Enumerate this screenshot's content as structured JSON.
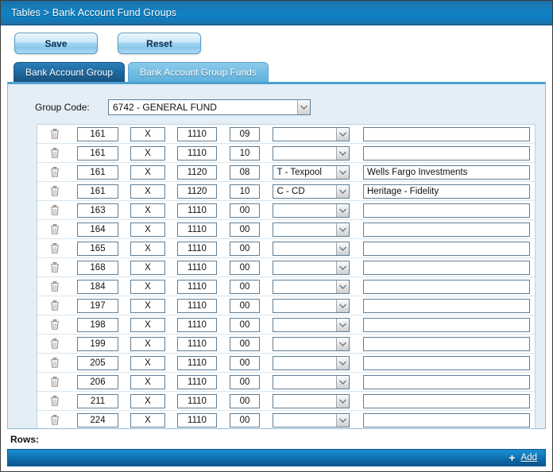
{
  "window": {
    "breadcrumb": "Tables > Bank Account Fund Groups"
  },
  "toolbar": {
    "save_label": "Save",
    "reset_label": "Reset"
  },
  "tabs": [
    {
      "label": "Bank Account Group",
      "active": true
    },
    {
      "label": "Bank Account Group Funds",
      "active": false
    }
  ],
  "form": {
    "group_code_label": "Group Code:",
    "group_code_value": "6742 - GENERAL FUND"
  },
  "grid": {
    "delete_icon": "trash-icon",
    "rows": [
      {
        "fund": "161",
        "x": "X",
        "account": "1110",
        "sub": "09",
        "type": "",
        "description": ""
      },
      {
        "fund": "161",
        "x": "X",
        "account": "1110",
        "sub": "10",
        "type": "",
        "description": ""
      },
      {
        "fund": "161",
        "x": "X",
        "account": "1120",
        "sub": "08",
        "type": "T - Texpool",
        "description": "Wells Fargo Investments"
      },
      {
        "fund": "161",
        "x": "X",
        "account": "1120",
        "sub": "10",
        "type": "C - CD",
        "description": "Heritage - Fidelity"
      },
      {
        "fund": "163",
        "x": "X",
        "account": "1110",
        "sub": "00",
        "type": "",
        "description": ""
      },
      {
        "fund": "164",
        "x": "X",
        "account": "1110",
        "sub": "00",
        "type": "",
        "description": ""
      },
      {
        "fund": "165",
        "x": "X",
        "account": "1110",
        "sub": "00",
        "type": "",
        "description": ""
      },
      {
        "fund": "168",
        "x": "X",
        "account": "1110",
        "sub": "00",
        "type": "",
        "description": ""
      },
      {
        "fund": "184",
        "x": "X",
        "account": "1110",
        "sub": "00",
        "type": "",
        "description": ""
      },
      {
        "fund": "197",
        "x": "X",
        "account": "1110",
        "sub": "00",
        "type": "",
        "description": ""
      },
      {
        "fund": "198",
        "x": "X",
        "account": "1110",
        "sub": "00",
        "type": "",
        "description": ""
      },
      {
        "fund": "199",
        "x": "X",
        "account": "1110",
        "sub": "00",
        "type": "",
        "description": ""
      },
      {
        "fund": "205",
        "x": "X",
        "account": "1110",
        "sub": "00",
        "type": "",
        "description": ""
      },
      {
        "fund": "206",
        "x": "X",
        "account": "1110",
        "sub": "00",
        "type": "",
        "description": ""
      },
      {
        "fund": "211",
        "x": "X",
        "account": "1110",
        "sub": "00",
        "type": "",
        "description": ""
      },
      {
        "fund": "224",
        "x": "X",
        "account": "1110",
        "sub": "00",
        "type": "",
        "description": ""
      }
    ]
  },
  "footer": {
    "rows_label": "Rows:",
    "add_plus": "+",
    "add_label": "Add"
  },
  "colors": {
    "titlebar_blue": "#1082c4",
    "active_tab_blue": "#1f6ba2",
    "inactive_tab_blue": "#73bde4",
    "panel_bg": "#e4eef6",
    "addbar_blue": "#1179bb"
  }
}
